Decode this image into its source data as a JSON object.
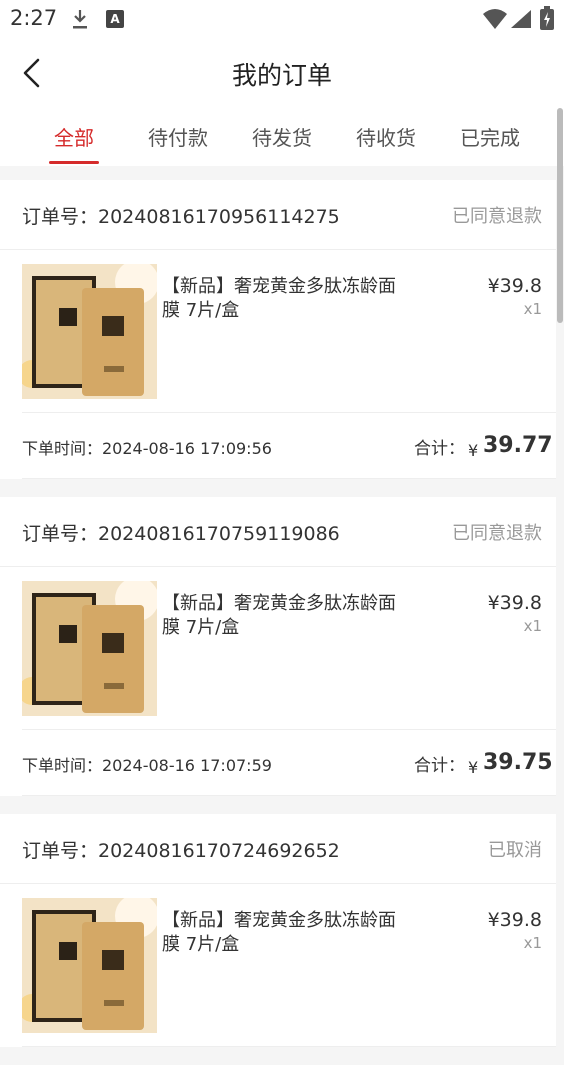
{
  "status_bar": {
    "time": "2:27",
    "a_icon": "A"
  },
  "header": {
    "title": "我的订单"
  },
  "tabs": [
    {
      "label": "全部"
    },
    {
      "label": "待付款"
    },
    {
      "label": "待发货"
    },
    {
      "label": "待收货"
    },
    {
      "label": "已完成"
    }
  ],
  "orders": [
    {
      "order_label": "订单号：20240816170956114275",
      "status": "已同意退款",
      "product_name": "【新品】奢宠黄金多肽冻龄面膜 7片/盒",
      "price": "¥39.8",
      "qty": "x1",
      "order_time": "下单时间：2024-08-16 17:09:56",
      "total_label": "合计：",
      "total_yen": "¥",
      "total_value": "39.77"
    },
    {
      "order_label": "订单号：20240816170759119086",
      "status": "已同意退款",
      "product_name": "【新品】奢宠黄金多肽冻龄面膜 7片/盒",
      "price": "¥39.8",
      "qty": "x1",
      "order_time": "下单时间：2024-08-16 17:07:59",
      "total_label": "合计：",
      "total_yen": "¥",
      "total_value": "39.75"
    },
    {
      "order_label": "订单号：20240816170724692652",
      "status": "已取消",
      "product_name": "【新品】奢宠黄金多肽冻龄面膜 7片/盒",
      "price": "¥39.8",
      "qty": "x1"
    }
  ],
  "colors": {
    "accent": "#d52b2b",
    "muted": "#999999"
  }
}
